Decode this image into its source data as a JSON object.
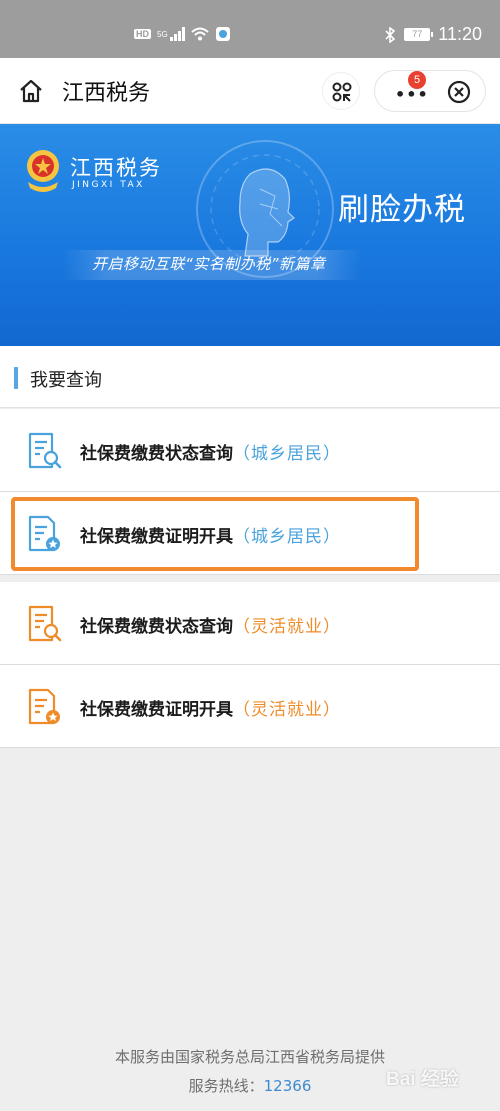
{
  "status_bar": {
    "network_badge": "HD",
    "network_type": "5G",
    "battery": "77",
    "time": "11:20"
  },
  "titlebar": {
    "title": "江西税务",
    "notification_count": "5"
  },
  "banner": {
    "logo_cn": "江西税务",
    "logo_en": "JINGXI TAX",
    "headline": "刷脸办税",
    "subline": "开启移动互联“实名制办税”新篇章"
  },
  "section": {
    "title": "我要查询"
  },
  "items": [
    {
      "label": "社保费缴费状态查询",
      "tag": "（城乡居民）",
      "icon": "document-search-icon",
      "color": "#4aa3dc"
    },
    {
      "label": "社保费缴费证明开具",
      "tag": "（城乡居民）",
      "icon": "document-certificate-icon",
      "color": "#4aa3dc"
    },
    {
      "label": "社保费缴费状态查询",
      "tag": "（灵活就业）",
      "icon": "document-search-icon",
      "color": "#ef8c2a"
    },
    {
      "label": "社保费缴费证明开具",
      "tag": "（灵活就业）",
      "icon": "document-certificate-icon",
      "color": "#ef8c2a"
    }
  ],
  "footer": {
    "provider": "本服务由国家税务总局江西省税务局提供",
    "hotline_label": "服务热线：",
    "hotline_number": "12366"
  },
  "watermark": "Bai 经验",
  "colors": {
    "accent_blue": "#4aa3dc",
    "accent_orange": "#ef8c2a",
    "highlight": "#f08a2c",
    "banner": "#1877de"
  }
}
